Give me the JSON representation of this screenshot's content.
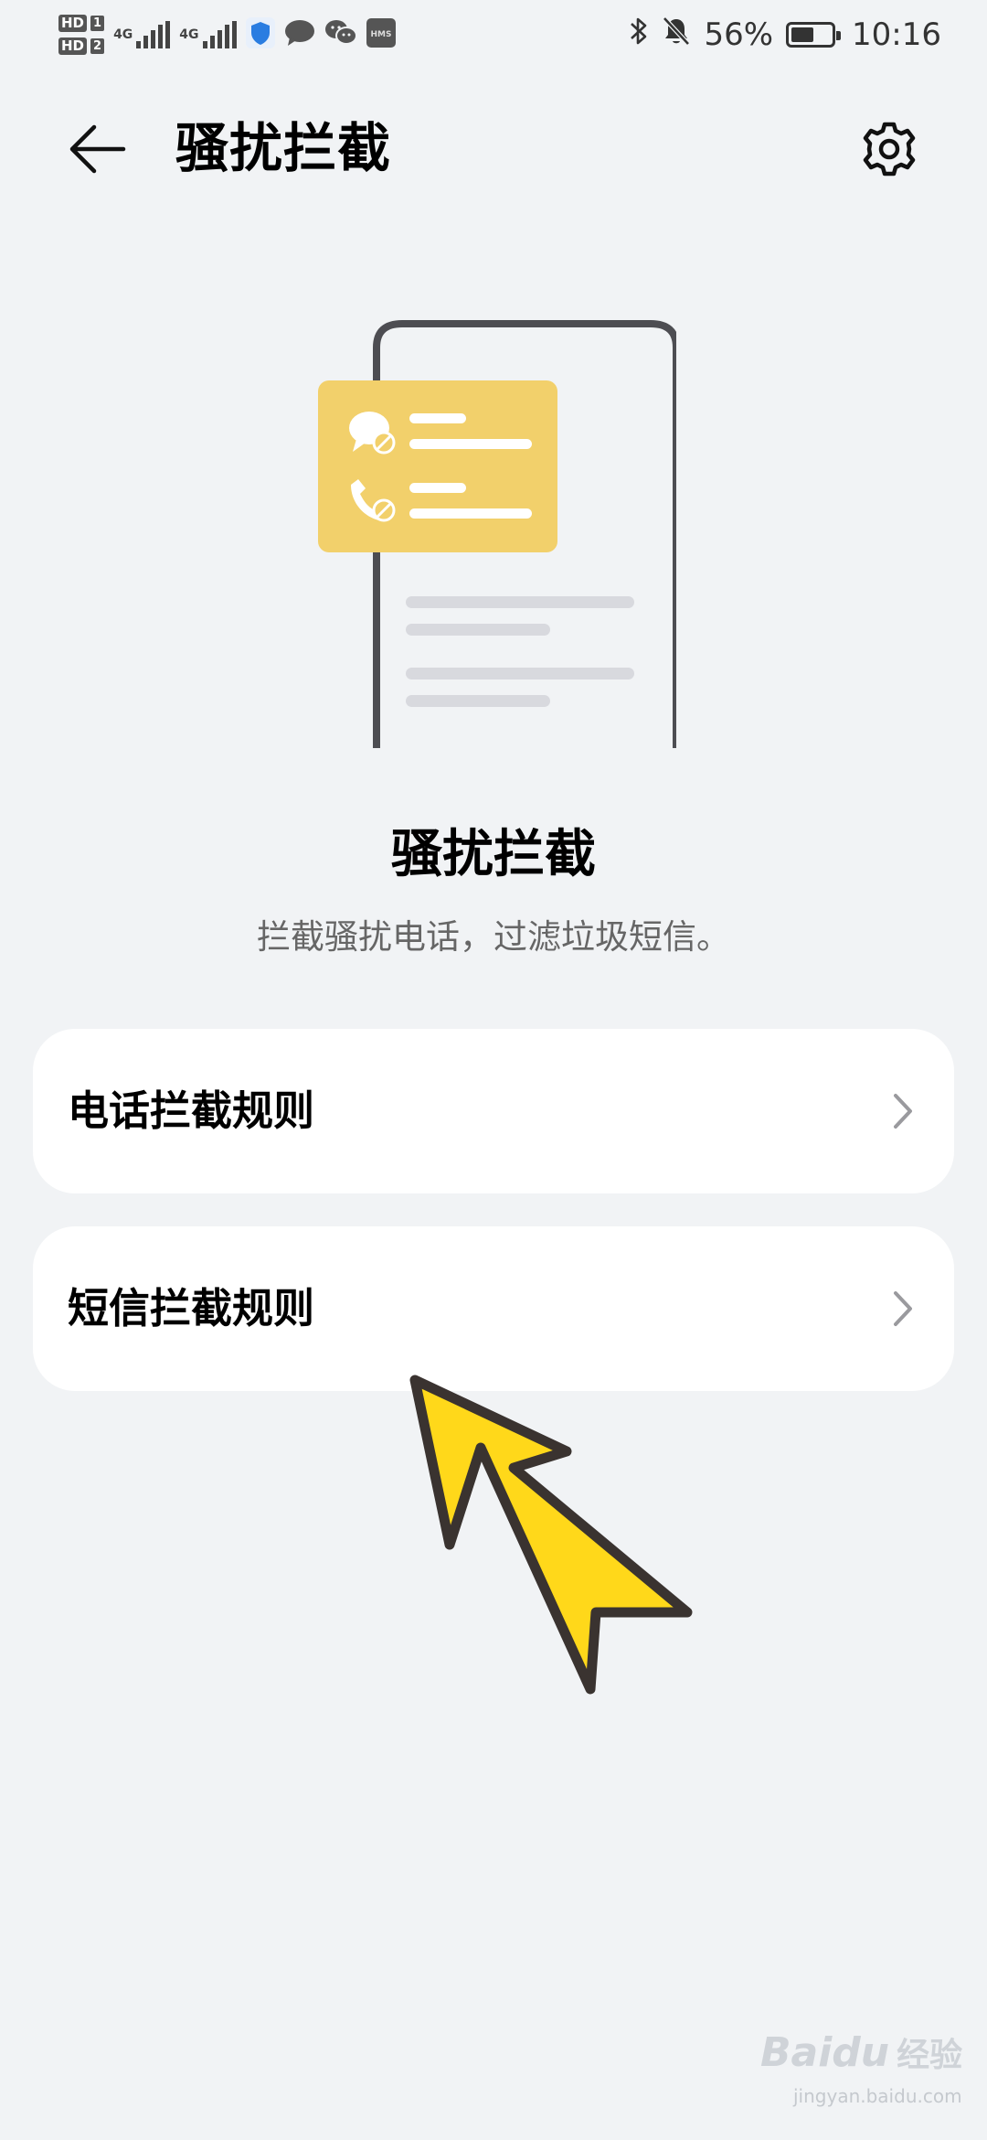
{
  "statusbar": {
    "sim1_badge": "HD",
    "sim1_num": "1",
    "sim2_badge": "HD",
    "sim2_num": "2",
    "net1": "4G",
    "net2": "4G",
    "hms_label": "HMS",
    "battery_percent": "56%",
    "battery_level": 0.56,
    "time": "10:16",
    "icons": [
      "shield-icon",
      "message-bubble-icon",
      "wechat-icon",
      "hms-icon",
      "bluetooth-icon",
      "bell-muted-icon"
    ]
  },
  "header": {
    "title": "骚扰拦截",
    "back_icon": "arrow-left-icon",
    "settings_icon": "gear-icon"
  },
  "hero": {
    "title": "骚扰拦截",
    "subtitle": "拦截骚扰电话，过滤垃圾短信。"
  },
  "menu": {
    "items": [
      {
        "label": "电话拦截规则",
        "icon": "chevron-right-icon"
      },
      {
        "label": "短信拦截规则",
        "icon": "chevron-right-icon"
      }
    ]
  },
  "watermark": {
    "brand": "Baidu",
    "cn": "经验",
    "url": "jingyan.baidu.com"
  },
  "colors": {
    "background": "#f1f3f5",
    "card": "#ffffff",
    "illustration_card": "#f2d06b",
    "pointer_fill": "#ffd81a",
    "pointer_stroke": "#3a3330"
  }
}
